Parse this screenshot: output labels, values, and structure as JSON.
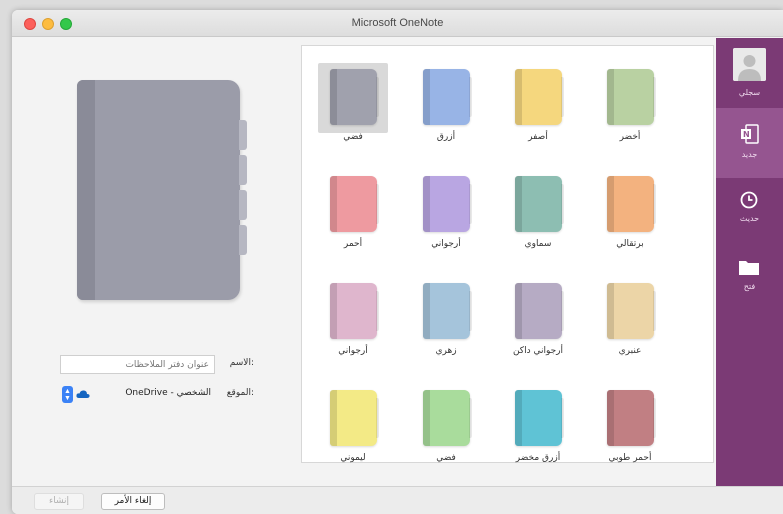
{
  "window": {
    "title": "Microsoft OneNote"
  },
  "form": {
    "name_label": "الاسم:",
    "name_placeholder": "عنوان دفتر الملاحظات",
    "location_label": "الموقع:",
    "location_value": "الشخصي - OneDrive"
  },
  "notebooks": [
    {
      "label": "أخضر",
      "color": "#b9d1a2"
    },
    {
      "label": "أصفر",
      "color": "#f5d77e"
    },
    {
      "label": "أزرق",
      "color": "#98b4e6"
    },
    {
      "label": "فضي",
      "color": "#a0a1ad",
      "selected": true
    },
    {
      "label": "برتقالي",
      "color": "#f3b27f"
    },
    {
      "label": "سماوي",
      "color": "#8dbeb2"
    },
    {
      "label": "أرجواني",
      "color": "#b9a6e2"
    },
    {
      "label": "أحمر",
      "color": "#ee9aa0"
    },
    {
      "label": "عنبري",
      "color": "#ecd5a7"
    },
    {
      "label": "أرجواني داكن",
      "color": "#b6abc4"
    },
    {
      "label": "زهري",
      "color": "#a5c4db"
    },
    {
      "label": "أرجواني",
      "color": "#dfb6cd"
    },
    {
      "label": "أحمر طوبي",
      "color": "#c17f83"
    },
    {
      "label": "أزرق مخضر",
      "color": "#5fc3d5"
    },
    {
      "label": "فضي",
      "color": "#a9dc9c"
    },
    {
      "label": "ليموني",
      "color": "#f3ea86"
    }
  ],
  "sidebar": {
    "items": [
      {
        "label": "سجلي",
        "icon": "account-avatar-icon"
      },
      {
        "label": "جديد",
        "icon": "new-notebook-icon",
        "active": true
      },
      {
        "label": "حديث",
        "icon": "clock-icon"
      },
      {
        "label": "فتح",
        "icon": "folder-icon"
      }
    ]
  },
  "buttons": {
    "create": "إنشاء",
    "cancel": "إلغاء الأمر"
  },
  "colors": {
    "sidebar": "#7b3a75",
    "sidebar_active": "#955590",
    "preview_book": "#9b9ca9"
  }
}
